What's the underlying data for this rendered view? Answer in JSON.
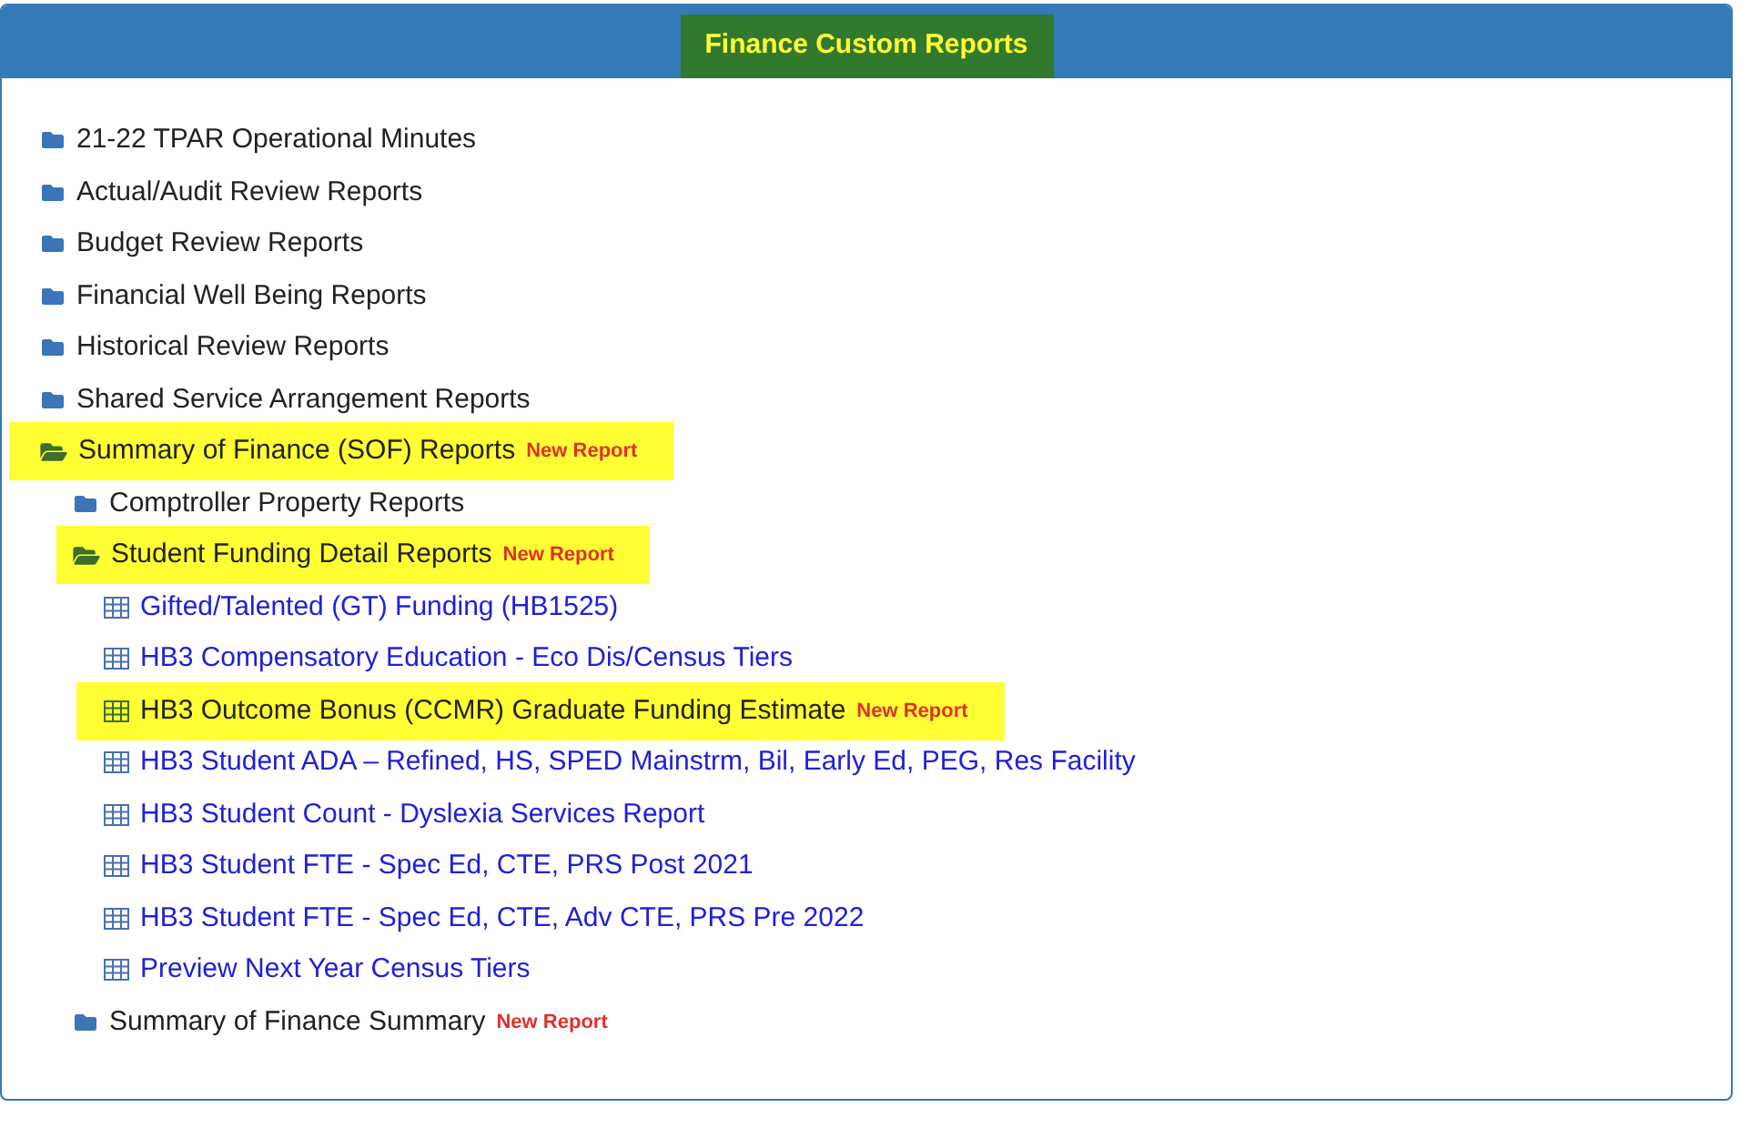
{
  "header": {
    "title": "Finance Custom Reports"
  },
  "tree": [
    {
      "kind": "folder",
      "label": "21-22 TPAR Operational Minutes",
      "expanded": false,
      "highlighted": false
    },
    {
      "kind": "folder",
      "label": "Actual/Audit Review Reports",
      "expanded": false,
      "highlighted": false
    },
    {
      "kind": "folder",
      "label": "Budget Review Reports",
      "expanded": false,
      "highlighted": false
    },
    {
      "kind": "folder",
      "label": "Financial Well Being Reports",
      "expanded": false,
      "highlighted": false
    },
    {
      "kind": "folder",
      "label": "Historical Review Reports",
      "expanded": false,
      "highlighted": false
    },
    {
      "kind": "folder",
      "label": "Shared Service Arrangement Reports",
      "expanded": false,
      "highlighted": false
    },
    {
      "kind": "folder",
      "label": "Summary of Finance (SOF) Reports",
      "badge": "New Report",
      "expanded": true,
      "highlighted": true,
      "children": [
        {
          "kind": "folder",
          "label": "Comptroller Property Reports",
          "expanded": false,
          "highlighted": false
        },
        {
          "kind": "folder",
          "label": "Student Funding Detail Reports",
          "badge": "New Report",
          "expanded": true,
          "highlighted": true,
          "children": [
            {
              "kind": "report",
              "label": "Gifted/Talented (GT) Funding (HB1525)",
              "highlighted": false
            },
            {
              "kind": "report",
              "label": "HB3 Compensatory Education - Eco Dis/Census Tiers",
              "highlighted": false
            },
            {
              "kind": "report",
              "label": "HB3 Outcome Bonus (CCMR) Graduate Funding Estimate",
              "badge": "New Report",
              "highlighted": true
            },
            {
              "kind": "report",
              "label": "HB3 Student ADA – Refined, HS, SPED Mainstrm, Bil, Early Ed, PEG, Res Facility",
              "highlighted": false
            },
            {
              "kind": "report",
              "label": "HB3 Student Count - Dyslexia Services Report",
              "highlighted": false
            },
            {
              "kind": "report",
              "label": "HB3 Student FTE - Spec Ed, CTE, PRS Post 2021",
              "highlighted": false
            },
            {
              "kind": "report",
              "label": "HB3 Student FTE - Spec Ed, CTE, Adv CTE, PRS Pre 2022",
              "highlighted": false
            },
            {
              "kind": "report",
              "label": "Preview Next Year Census Tiers",
              "highlighted": false
            }
          ]
        },
        {
          "kind": "folder",
          "label": "Summary of Finance Summary",
          "badge": "New Report",
          "expanded": false,
          "highlighted": false
        }
      ]
    }
  ]
}
